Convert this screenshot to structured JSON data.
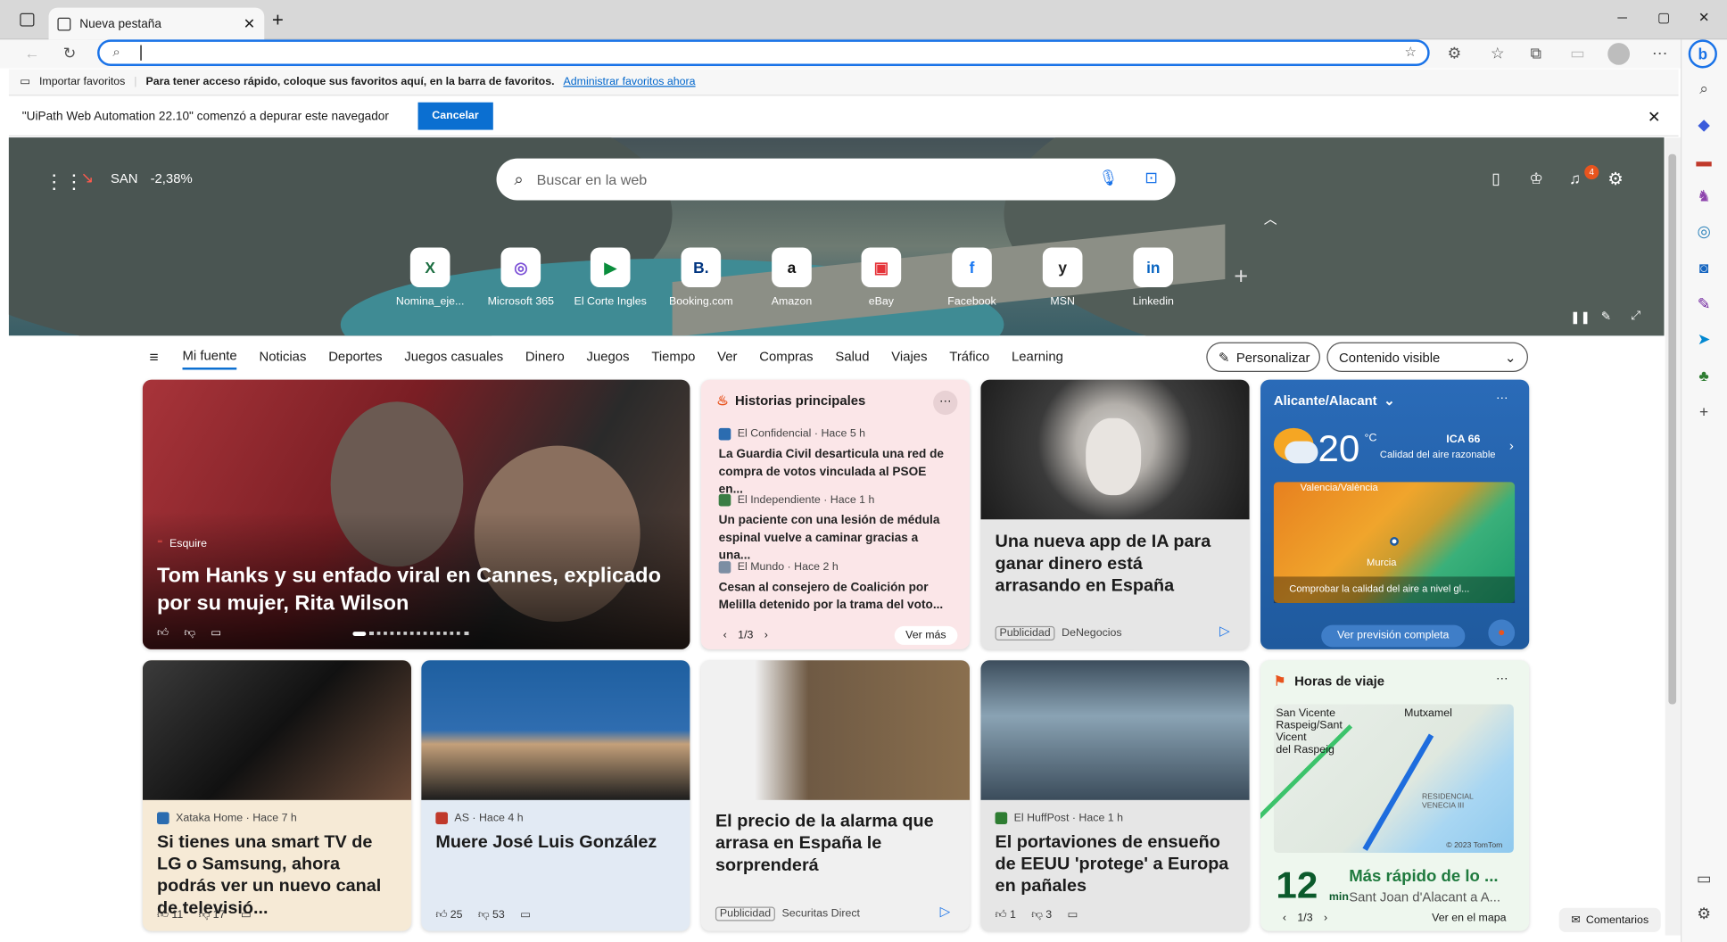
{
  "browser": {
    "tab_title": "Nueva pestaña",
    "tab_close": "✕",
    "new_tab": "+",
    "min": "─",
    "max": "▢",
    "close": "✕"
  },
  "favbar": {
    "import": "Importar favoritos",
    "hint": "Para tener acceso rápido, coloque sus favoritos aquí, en la barra de favoritos.",
    "manage": "Administrar favoritos ahora"
  },
  "debug": {
    "message": "\"UiPath Web Automation 22.10\" comenzó a depurar este navegador",
    "cancel": "Cancelar"
  },
  "hero": {
    "stock": "SAN",
    "stock_change": "-2,38%",
    "search_placeholder": "Buscar en la web",
    "notif_count": "4",
    "tiles": [
      {
        "label": "Nomina_eje...",
        "icon": "X",
        "color": "#1d6f42"
      },
      {
        "label": "Microsoft 365",
        "icon": "◎",
        "color": "#7b4fd6"
      },
      {
        "label": "El Corte Ingles",
        "icon": "▶",
        "color": "#0a8d3c"
      },
      {
        "label": "Booking.com",
        "icon": "B.",
        "color": "#003580"
      },
      {
        "label": "Amazon",
        "icon": "a",
        "color": "#111"
      },
      {
        "label": "eBay",
        "icon": "▣",
        "color": "#e53238"
      },
      {
        "label": "Facebook",
        "icon": "f",
        "color": "#1877f2"
      },
      {
        "label": "MSN",
        "icon": "y",
        "color": "#222"
      },
      {
        "label": "Linkedin",
        "icon": "in",
        "color": "#0a66c2"
      }
    ]
  },
  "nav": {
    "items": [
      "Mi fuente",
      "Noticias",
      "Deportes",
      "Juegos casuales",
      "Dinero",
      "Juegos",
      "Tiempo",
      "Ver",
      "Compras",
      "Salud",
      "Viajes",
      "Tráfico",
      "Learning"
    ],
    "personalize": "Personalizar",
    "visible": "Contenido visible"
  },
  "hero_card": {
    "source": "Esquire",
    "title": "Tom Hanks y su enfado viral en Cannes, explicado por su mujer, Rita Wilson"
  },
  "top_stories": {
    "header": "Historias principales",
    "pager": "1/3",
    "more": "Ver más",
    "items": [
      {
        "source": "El Confidencial · Hace 5 h",
        "title": "La Guardia Civil desarticula una red de compra de votos vinculada al PSOE en..."
      },
      {
        "source": "El Independiente · Hace 1 h",
        "title": "Un paciente con una lesión de médula espinal vuelve a caminar gracias a una..."
      },
      {
        "source": "El Mundo · Hace 2 h",
        "title": "Cesan al consejero de Coalición por Melilla detenido por la trama del voto..."
      }
    ]
  },
  "ad_card": {
    "title": "Una nueva app de IA para ganar dinero está arrasando en España",
    "ad": "Publicidad",
    "sponsor": "DeNegocios"
  },
  "weather": {
    "location": "Alicante/Alacant",
    "temp": "20",
    "unit": "°C",
    "aqi": "ICA 66",
    "aqi_text": "Calidad del aire razonable",
    "map_label_1": "Valencia/València",
    "map_label_2": "Murcia",
    "check": "Comprobar la calidad del aire a nivel gl...",
    "forecast": "Ver previsión completa"
  },
  "row2": [
    {
      "source": "Xataka Home · Hace 7 h",
      "title": "Si tienes una smart TV de LG o Samsung, ahora podrás ver un nuevo canal de televisió...",
      "likes": "11",
      "dislikes": "17"
    },
    {
      "source": "AS · Hace 4 h",
      "title": "Muere José Luis González",
      "likes": "25",
      "dislikes": "53"
    },
    {
      "source": "",
      "title": "El precio de la alarma que arrasa en España le sorprenderá",
      "ad": "Publicidad",
      "sponsor": "Securitas Direct"
    },
    {
      "source": "El HuffPost · Hace 1 h",
      "title": "El portaviones de ensueño de EEUU 'protege' a Europa en pañales",
      "likes": "1",
      "dislikes": "3"
    }
  ],
  "travel": {
    "header": "Horas de viaje",
    "minutes": "12",
    "unit": "min",
    "title": "Más rápido de lo ...",
    "dest": "Sant Joan d'Alacant a A...",
    "pager": "1/3",
    "map_link": "Ver en el mapa",
    "map_labels": [
      "San Vicente",
      "Raspeig/Sant",
      "Vicent",
      "del Raspeig",
      "Mutxamel",
      "RESIDENCIAL",
      "VENECIA III"
    ],
    "copyright": "© 2023 TomTom"
  },
  "feedback": "Comentarios"
}
